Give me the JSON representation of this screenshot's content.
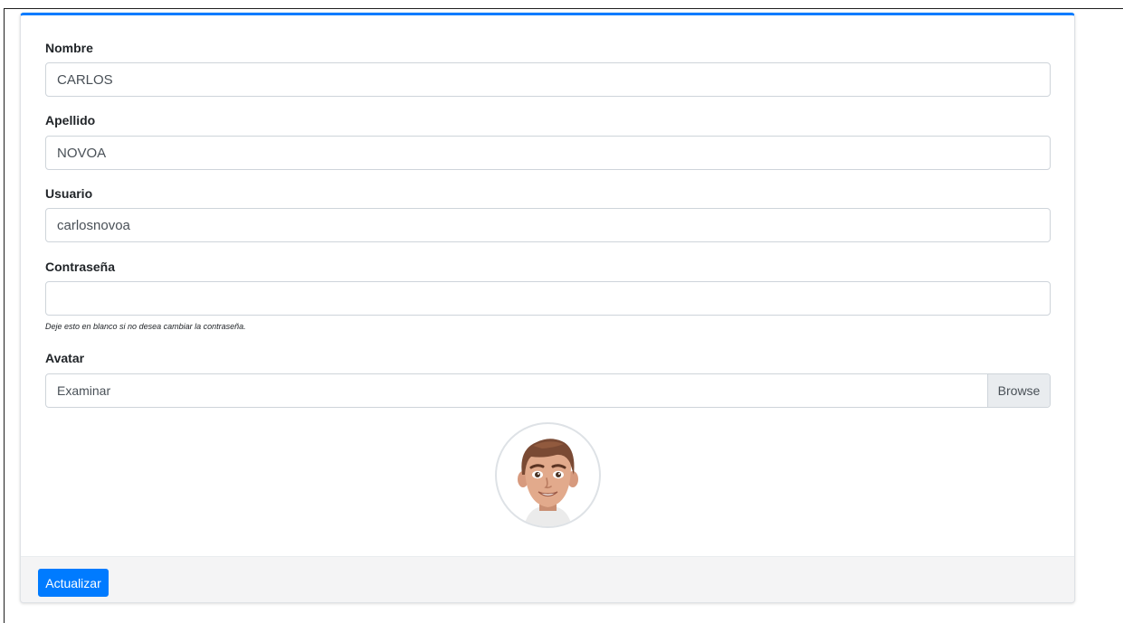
{
  "colors": {
    "primary": "#007bff",
    "input_border": "#ced4da",
    "footer_bg": "#f4f4f5",
    "addon_bg": "#e9ecef"
  },
  "form": {
    "nombre": {
      "label": "Nombre",
      "value": "CARLOS"
    },
    "apellido": {
      "label": "Apellido",
      "value": "NOVOA"
    },
    "usuario": {
      "label": "Usuario",
      "value": "carlosnovoa"
    },
    "contrasena": {
      "label": "Contraseña",
      "value": "",
      "help": "Deje esto en blanco si no desea cambiar la contraseña."
    },
    "avatar": {
      "label": "Avatar",
      "file_text": "Examinar",
      "browse_label": "Browse",
      "image_icon": "cartoon-male-avatar"
    }
  },
  "footer": {
    "submit_label": "Actualizar"
  }
}
